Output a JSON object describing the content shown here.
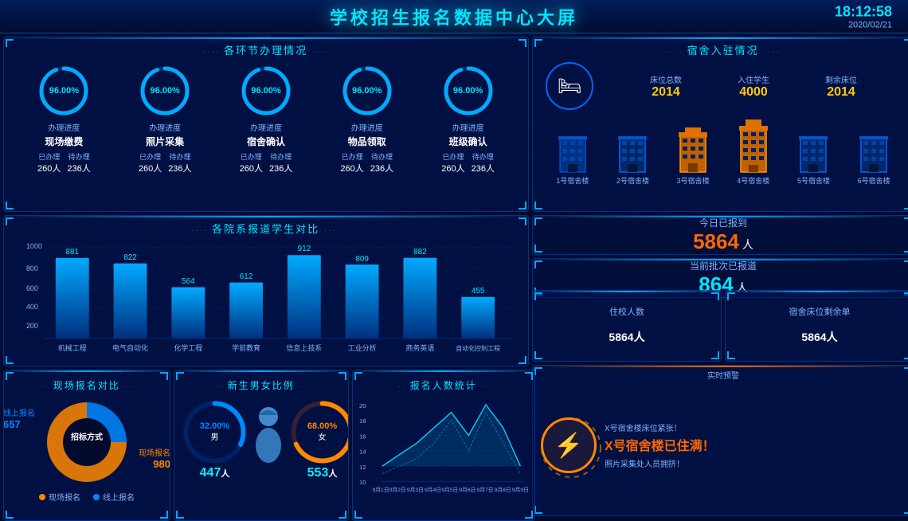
{
  "header": {
    "title": "学校招生报名数据中心大屏",
    "time": "18:12:58",
    "date": "2020/02/21"
  },
  "process": {
    "title": "各环节办理情况",
    "items": [
      {
        "pct": "96.00%",
        "label": "办理进度",
        "name": "现场缴费",
        "done": "260人",
        "pending": "236人"
      },
      {
        "pct": "96.00%",
        "label": "办理进度",
        "name": "照片采集",
        "done": "260人",
        "pending": "236人"
      },
      {
        "pct": "96.00%",
        "label": "办理进度",
        "name": "宿舍确认",
        "done": "260人",
        "pending": "236人"
      },
      {
        "pct": "96.00%",
        "label": "办理进度",
        "name": "物品领取",
        "done": "260人",
        "pending": "236人"
      },
      {
        "pct": "96.00%",
        "label": "办理进度",
        "name": "班级确认",
        "done": "260人",
        "pending": "236人"
      }
    ],
    "done_label": "已办理",
    "pending_label": "待办理"
  },
  "dorm": {
    "title": "宿舍入驻情况",
    "beds_total_label": "床位总数",
    "students_label": "入住学生",
    "beds_remain_label": "剩余床位",
    "beds_total": "2014",
    "students": "4000",
    "beds_remain": "2014",
    "buildings": [
      {
        "label": "1号宿舍楼",
        "filled": false
      },
      {
        "label": "2号宿舍楼",
        "filled": false
      },
      {
        "label": "3号宿舍楼",
        "filled": true
      },
      {
        "label": "4号宿舍楼",
        "filled": true
      },
      {
        "label": "5号宿舍楼",
        "filled": false
      },
      {
        "label": "6号宿舍楼",
        "filled": false
      }
    ]
  },
  "bar_chart": {
    "title": "各院系报道学生对比",
    "data": [
      {
        "label": "机械工程",
        "value": 881
      },
      {
        "label": "电气自动化",
        "value": 822
      },
      {
        "label": "化学工程",
        "value": 564
      },
      {
        "label": "学前教育",
        "value": 612
      },
      {
        "label": "信息上技系",
        "value": 912
      },
      {
        "label": "工业分析",
        "value": 809
      },
      {
        "label": "商务英语",
        "value": 882
      },
      {
        "label": "自动化控制工程",
        "value": 455
      }
    ],
    "y_max": 1000
  },
  "today": {
    "today_label": "今日已报到",
    "today_value": "5864",
    "today_unit": "人",
    "batch_label": "当前批次已报道",
    "batch_value": "864",
    "batch_unit": "人"
  },
  "dorm_people": {
    "live_label": "住校人数",
    "live_value": "5864",
    "live_unit": "人",
    "remain_label": "宿舍床位剩余单",
    "remain_value": "5864",
    "remain_unit": "人"
  },
  "alert": {
    "title": "实时预警",
    "line1": "X号宿舍楼床位紧张！",
    "big": "X号宿舍楼已住满！",
    "line2": "照片采集处人员拥挤！"
  },
  "pie": {
    "title": "现场报名对比",
    "center_label": "招标方式",
    "online_label": "线上报名",
    "online_value": 657,
    "offline_label": "现场报名",
    "offline_value": 980,
    "online_pct": 40,
    "offline_pct": 60
  },
  "gender": {
    "title": "新生男女比例",
    "male_pct": "32.00%",
    "female_pct": "68.00%",
    "male_count": "447",
    "female_count": "553",
    "unit": "人",
    "male_label": "男",
    "female_label": "女"
  },
  "line_chart": {
    "title": "报名人数统计",
    "x_labels": [
      "9月1日",
      "9月2日",
      "9月3日",
      "9月4日",
      "9月5日",
      "9月6日",
      "9月7日",
      "9月8日",
      "9月9日"
    ],
    "y_labels": [
      "10",
      "12",
      "14",
      "16",
      "18",
      "20"
    ],
    "data1": [
      11,
      12.5,
      14,
      16,
      18,
      15,
      19,
      16,
      11
    ],
    "data2": [
      10,
      11,
      12,
      14,
      17,
      13,
      18,
      14,
      10
    ]
  }
}
